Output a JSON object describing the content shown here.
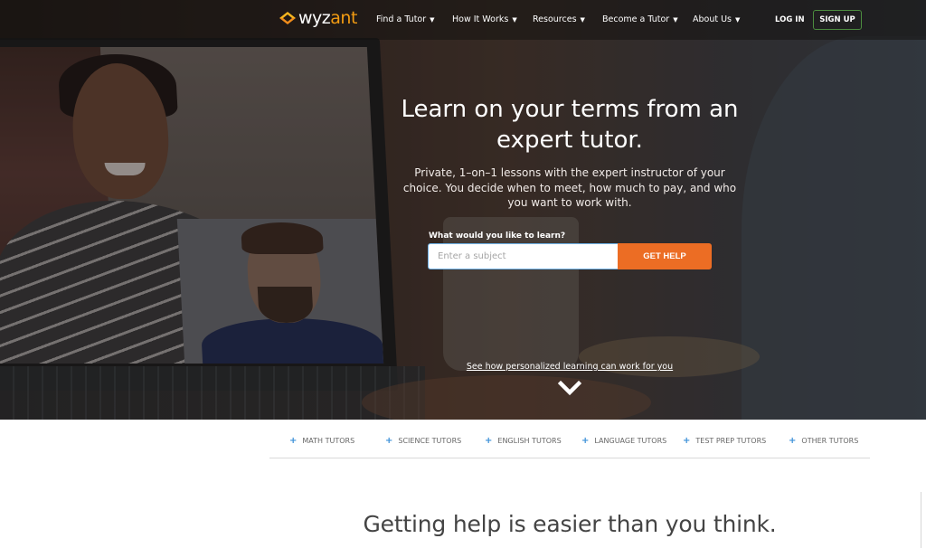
{
  "nav": {
    "logo": {
      "prefix": "wyz",
      "accent": "ant"
    },
    "items": [
      {
        "label": "Find a Tutor"
      },
      {
        "label": "How It Works"
      },
      {
        "label": "Resources"
      },
      {
        "label": "Become a Tutor"
      },
      {
        "label": "About Us"
      }
    ],
    "login_label": "LOG IN",
    "signup_label": "SIGN UP"
  },
  "hero": {
    "title": "Learn on your terms from an expert tutor.",
    "subtitle": "Private, 1–on–1 lessons with the expert instructor of your choice. You decide when to meet, how much to pay, and who you want to work with.",
    "search_label": "What would you like to learn?",
    "search_placeholder": "Enter a subject",
    "search_value": "",
    "button_label": "GET HELP",
    "link_label": "See how personalized learning can work for you"
  },
  "subjects": [
    {
      "label": "MATH TUTORS"
    },
    {
      "label": "SCIENCE TUTORS"
    },
    {
      "label": "ENGLISH TUTORS"
    },
    {
      "label": "LANGUAGE TUTORS"
    },
    {
      "label": "TEST PREP TUTORS"
    },
    {
      "label": "OTHER TUTORS"
    }
  ],
  "section": {
    "title": "Getting help is easier than you think."
  },
  "colors": {
    "accent_orange": "#ec6d24",
    "logo_orange": "#f39c12",
    "signup_border": "#4c8c3f",
    "subject_plus": "#3a8fd8"
  }
}
